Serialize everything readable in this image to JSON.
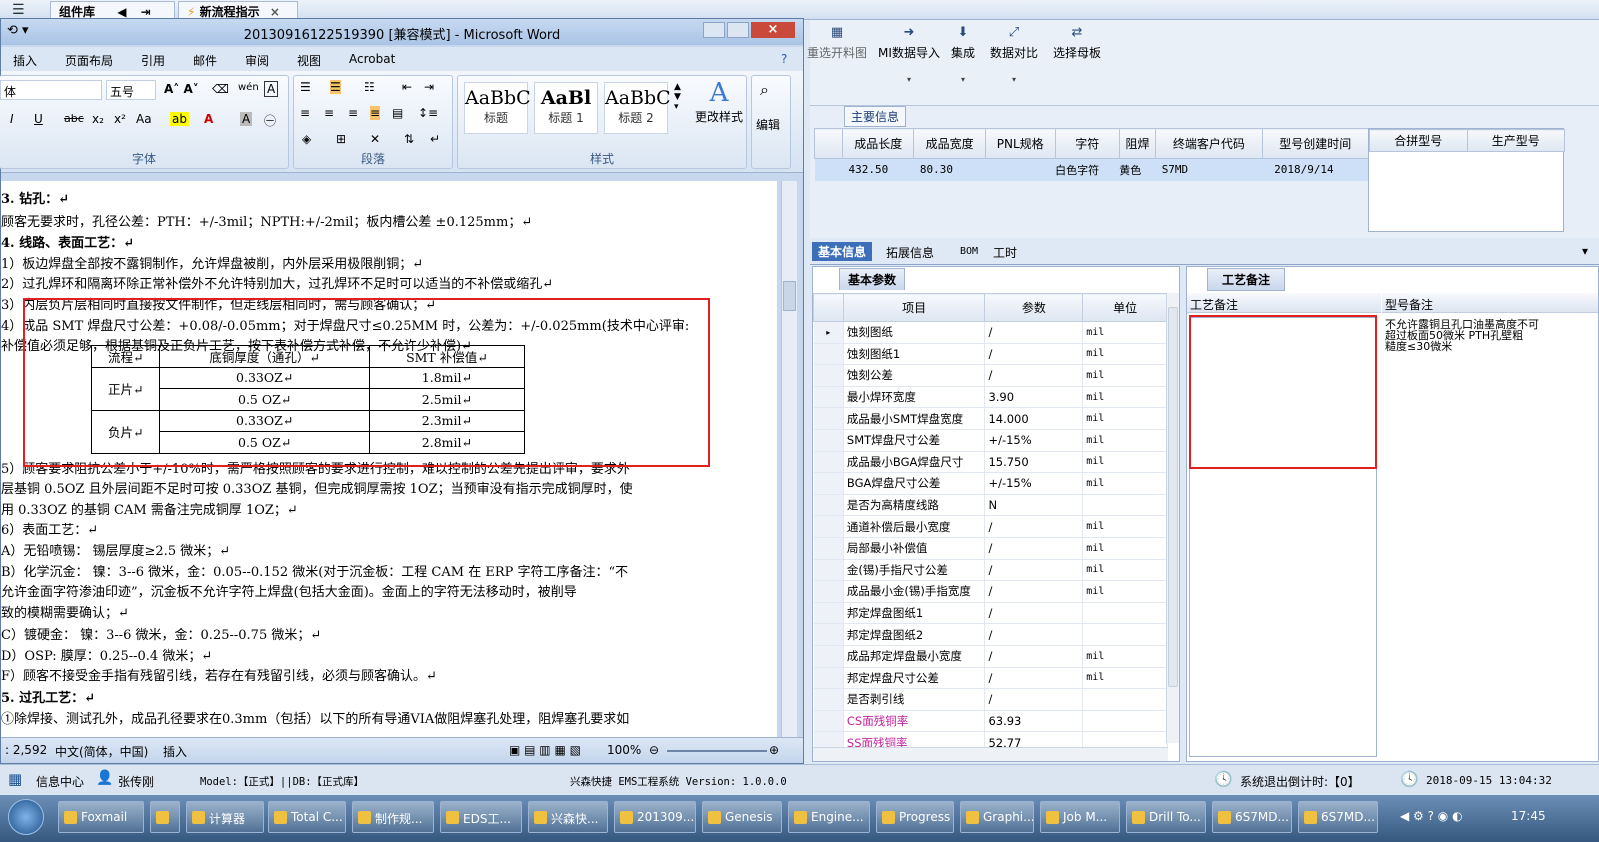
{
  "back": {
    "tab1": "组件库",
    "tab2": "新流程指示"
  },
  "toolbar": [
    {
      "label": "重选开料图",
      "icon": "image-icon"
    },
    {
      "label": "MI数据导入",
      "icon": "import-icon"
    },
    {
      "label": "集成",
      "icon": "download-icon"
    },
    {
      "label": "数据对比",
      "icon": "compare-icon"
    },
    {
      "label": "选择母板",
      "icon": "shuffle-icon"
    }
  ],
  "maininfo": {
    "title": "主要信息",
    "headers": [
      "成品长度",
      "成品宽度",
      "PNL规格",
      "字符",
      "阻焊",
      "终端客户代码",
      "型号创建时间"
    ],
    "row": [
      "432.50",
      "80.30",
      "",
      "白色字符",
      "黄色",
      "S7MD",
      "2018/9/14"
    ],
    "right_headers": [
      "合拼型号",
      "生产型号"
    ]
  },
  "subtabs": {
    "t1": "基本信息",
    "t2": "拓展信息",
    "t3": "BOM",
    "t4": "工时"
  },
  "params": {
    "title": "基本参数",
    "h_item": "项目",
    "h_param": "参数",
    "h_unit": "单位",
    "rows": [
      [
        "蚀刻图纸",
        "/",
        "mil"
      ],
      [
        "蚀刻图纸1",
        "/",
        "mil"
      ],
      [
        "蚀刻公差",
        "/",
        "mil"
      ],
      [
        "最小焊环宽度",
        "3.90",
        "mil"
      ],
      [
        "成品最小SMT焊盘宽度",
        "14.000",
        "mil"
      ],
      [
        "SMT焊盘尺寸公差",
        "+/-15%",
        "mil"
      ],
      [
        "成品最小BGA焊盘尺寸",
        "15.750",
        "mil"
      ],
      [
        "BGA焊盘尺寸公差",
        "+/-15%",
        "mil"
      ],
      [
        "是否为高精度线路",
        "N",
        ""
      ],
      [
        "通道补偿后最小宽度",
        "/",
        "mil"
      ],
      [
        "局部最小补偿值",
        "/",
        "mil"
      ],
      [
        "金(锡)手指尺寸公差",
        "/",
        "mil"
      ],
      [
        "成品最小金(锡)手指宽度",
        "/",
        "mil"
      ],
      [
        "邦定焊盘图纸1",
        "/",
        ""
      ],
      [
        "邦定焊盘图纸2",
        "/",
        ""
      ],
      [
        "成品邦定焊盘最小宽度",
        "/",
        "mil"
      ],
      [
        "邦定焊盘尺寸公差",
        "/",
        "mil"
      ],
      [
        "是否剥引线",
        "/",
        ""
      ],
      [
        "CS面残铜率",
        "63.93",
        ""
      ],
      [
        "SS面残铜率",
        "52.77",
        ""
      ]
    ]
  },
  "remark": {
    "tab": "工艺备注",
    "col1": "工艺备注",
    "col2": "型号备注",
    "text1": "不允许露铜且孔口油墨高度不可",
    "text2": "超过板面50微米     PTH孔壁粗",
    "text3": "糙度≤30微米"
  },
  "status": {
    "info": "信息中心",
    "user": "张传刚",
    "model": "Model:【正式】||DB:【正式库】",
    "system": "兴森快捷 EMS工程系统 Version: 1.0.0.0",
    "countdown": "系统退出倒计时:【0】",
    "datetime": "2018-09-15 13:04:32"
  },
  "taskbar": {
    "items": [
      "Foxmail",
      "",
      "计算器",
      "Total C...",
      "制作规...",
      "EDS工...",
      "兴森快...",
      "201309...",
      "Genesis",
      "Engine...",
      "Progress",
      "Graphi...",
      "Job M...",
      "Drill To...",
      "6S7MD...",
      "6S7MD..."
    ],
    "time": "17:45"
  },
  "word": {
    "title": "20130916122519390 [兼容模式] - Microsoft Word",
    "menu": [
      "插入",
      "页面布局",
      "引用",
      "邮件",
      "审阅",
      "视图",
      "Acrobat"
    ],
    "font": "体",
    "size": "五号",
    "groups": {
      "font": "字体",
      "para": "段落",
      "styles": "样式",
      "edit": "编辑",
      "change_styles": "更改样式"
    },
    "styles": [
      {
        "prev": "AaBbC",
        "name": "标题"
      },
      {
        "prev": "AaBl",
        "name": "标题 1"
      },
      {
        "prev": "AaBbC",
        "name": "标题 2"
      }
    ],
    "status": {
      "pages": ": 2,592",
      "lang": "中文(简体，中国)",
      "mode": "插入",
      "zoom": "100%"
    },
    "lines": [
      "3.  钻孔：↵",
      "    顾客无要求时，孔径公差：PTH：+/-3mil；NPTH:+/-2mil；板内槽公差 ±0.125mm；↵",
      "4.  线路、表面工艺：↵",
      "    1）板边焊盘全部按不露铜制作，允许焊盘被削，内外层采用极限削铜；↵",
      "    2）过孔焊环和隔离环除正常补偿外不允许特别加大，过孔焊环不足时可以适当的不补偿或缩孔↵",
      "    3）内层负片层相同时直接按文件制作，但走线层相同时，需与顾客确认；↵",
      "    4）成品 SMT 焊盘尺寸公差：+0.08/-0.05mm；对于焊盘尺寸≤0.25MM 时，公差为：+/-0.025mm(技术中心评审:",
      "       补偿值必须足够，根据基铜及正负片工艺，按下表补偿方式补偿，不允许少补偿)↵",
      "    5）顾客要求阻抗公差小于+/-10%时，需严格按照顾客的要求进行控制，难以控制的公差先提出评审，要求外",
      "       层基铜 0.5OZ 且外层间距不足时可按 0.33OZ 基铜，但完成铜厚需按 1OZ；当预审没有指示完成铜厚时，使",
      "       用 0.33OZ 的基铜 CAM 需备注完成铜厚 1OZ；↵",
      "    6）表面工艺：↵",
      "      A）无铅喷锡：  锡层厚度≥2.5 微米；↵",
      "      B）化学沉金：  镍：3--6 微米，金：0.05--0.152 微米(对于沉金板：工程 CAM 在 ERP 字符工序备注：“不",
      "         允许金面字符渗油印迹”，沉金板不允许字符上焊盘(包括大金面)。金面上的字符无法移动时，被削导",
      "         致的模糊需要确认；↵",
      "      C）镀硬金：    镍：3--6 微米，金：0.25--0.75 微米；↵",
      "      D）OSP:        膜厚：0.25--0.4 微米；↵",
      "      F）顾客不接受金手指有残留引线，若存在有残留引线，必须与顾客确认。↵",
      "5.  过孔工艺：↵",
      "      ①除焊接、测试孔外，成品孔径要求在0.3mm（包括）以下的所有导通VIA做阻焊塞孔处理，阻焊塞孔要求如"
    ],
    "table": {
      "headers": [
        "流程↵",
        "底铜厚度（通孔）↵",
        "SMT 补偿值↵"
      ],
      "pos": "正片↵",
      "neg": "负片↵",
      "rows": [
        [
          "0.33OZ↵",
          "1.8mil↵"
        ],
        [
          "0.5 OZ↵",
          "2.5mil↵"
        ],
        [
          "0.33OZ↵",
          "2.3mil↵"
        ],
        [
          "0.5 OZ↵",
          "2.8mil↵"
        ]
      ]
    }
  }
}
